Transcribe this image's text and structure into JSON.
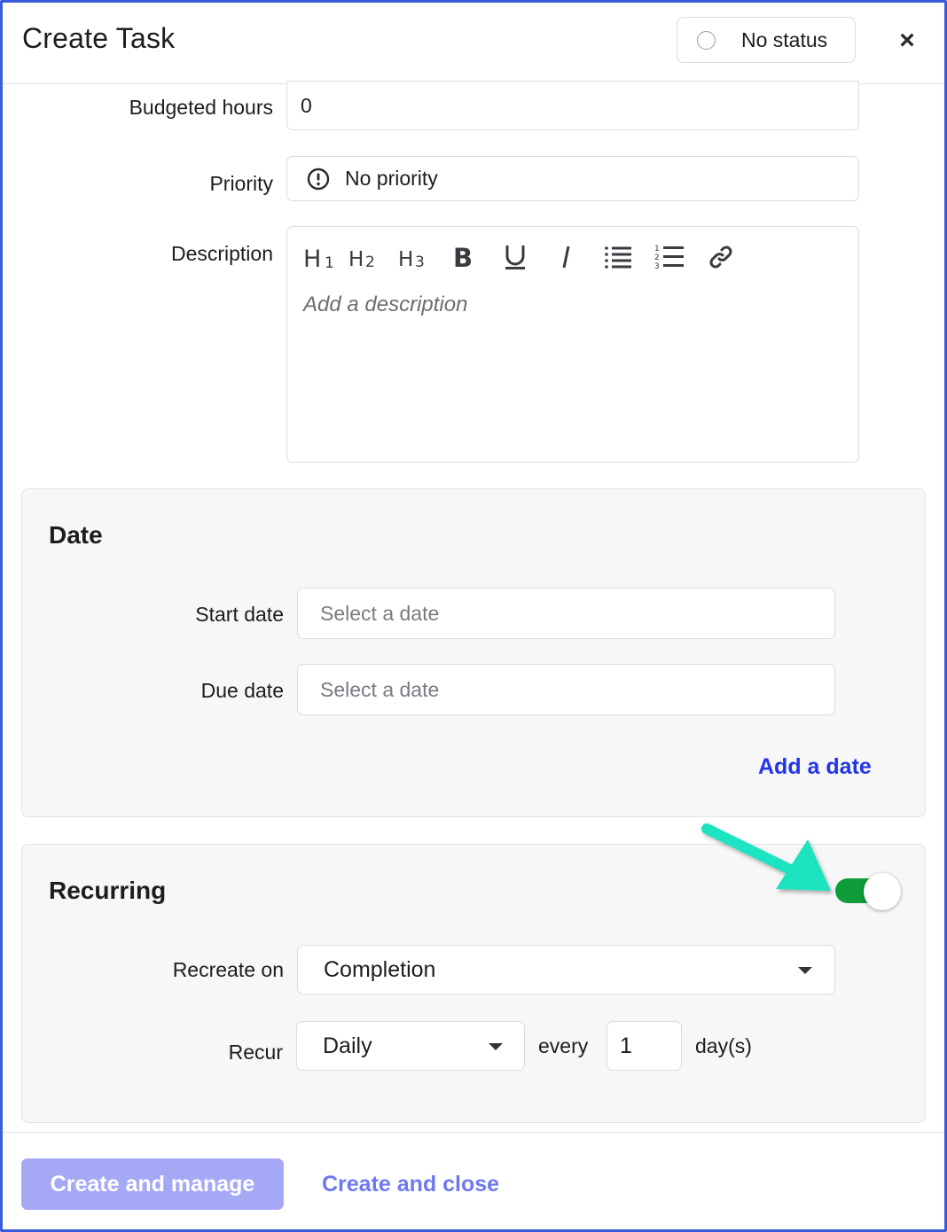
{
  "header": {
    "title": "Create Task",
    "status_label": "No status",
    "close_glyph": "×"
  },
  "form": {
    "budgeted_hours": {
      "label": "Budgeted hours",
      "value": "0"
    },
    "priority": {
      "label": "Priority",
      "value": "No priority",
      "icon": "exclamation-circle-icon"
    },
    "description": {
      "label": "Description",
      "placeholder": "Add a description",
      "toolbar": [
        "heading-1",
        "heading-2",
        "heading-3",
        "bold",
        "underline",
        "italic",
        "bulleted-list",
        "numbered-list",
        "link"
      ]
    }
  },
  "date_section": {
    "title": "Date",
    "start_date": {
      "label": "Start date",
      "placeholder": "Select a date"
    },
    "due_date": {
      "label": "Due date",
      "placeholder": "Select a date"
    },
    "add_date_link": "Add a date"
  },
  "recurring_section": {
    "title": "Recurring",
    "enabled": true,
    "recreate_on": {
      "label": "Recreate on",
      "value": "Completion"
    },
    "recur": {
      "label": "Recur",
      "frequency": "Daily",
      "every_label": "every",
      "interval": "1",
      "unit": "day(s)"
    }
  },
  "footer": {
    "create_manage": "Create and manage",
    "create_close": "Create and close"
  },
  "colors": {
    "accent": "#2235e8",
    "primary_disabled": "#a5a9f5",
    "toggle_on": "#0f9d3a",
    "annotation_arrow": "#1ee3c0",
    "frame_border": "#3b5bdb"
  }
}
